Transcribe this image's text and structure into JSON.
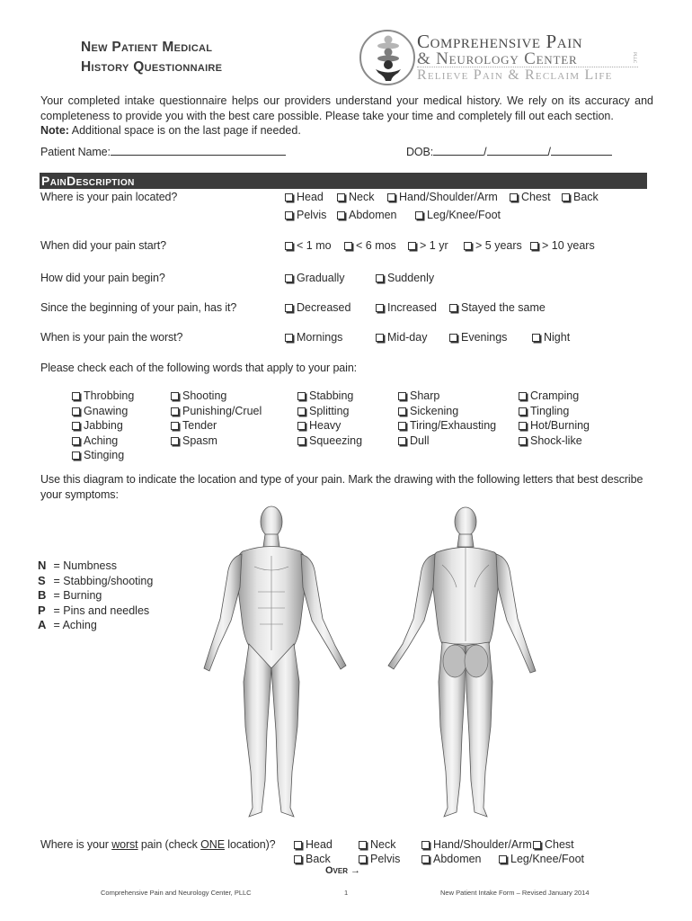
{
  "header": {
    "title_line1": "New Patient Medical",
    "title_line2": "History Questionnaire",
    "logo": {
      "line1": "Comprehensive Pain",
      "line2": "& Neurology Center",
      "pllc": "PLLC",
      "tagline": "Relieve Pain & Reclaim Life",
      "icon": "spine-figures-logo-icon",
      "colors": {
        "dark": "#2f2f2f",
        "mid": "#7a7a7a",
        "light": "#b0b0b0"
      }
    }
  },
  "intro": {
    "paragraph": "Your completed intake questionnaire helps our providers understand your medical history.  We rely on its accuracy and completeness to provide you with the best care possible.  Please take your time and completely fill out each section.",
    "note_label": "Note:",
    "note_text": "Additional space is on the last page if needed."
  },
  "patient": {
    "name_label": "Patient Name:",
    "name_value": "",
    "dob_label": "DOB:",
    "dob_month": "",
    "dob_day": "",
    "dob_year": "",
    "dob_separator": "/"
  },
  "section": {
    "title": "PainDescription",
    "bar_color": "#3c3c3c"
  },
  "questions": {
    "location": {
      "label": "Where is your pain located?",
      "options": [
        "Head",
        "Neck",
        "Hand/Shoulder/Arm",
        "Chest",
        "Back",
        "Pelvis",
        "Abdomen",
        "Leg/Knee/Foot"
      ]
    },
    "start": {
      "label": "When did your pain start?",
      "options": [
        "< 1 mo",
        "< 6 mos",
        "> 1 yr",
        "> 5 years",
        "> 10 years"
      ]
    },
    "begin": {
      "label": "How did your pain begin?",
      "options": [
        "Gradually",
        "Suddenly"
      ]
    },
    "since": {
      "label": "Since the beginning of your pain, has it?",
      "options": [
        "Decreased",
        "Increased",
        "Stayed the same"
      ]
    },
    "worst_time": {
      "label": "When is your pain the worst?",
      "options": [
        "Mornings",
        "Mid-day",
        "Evenings",
        "Night"
      ]
    },
    "words": {
      "label": "Please check each of the following words that apply to your pain:",
      "columns": [
        [
          "Throbbing",
          "Gnawing",
          "Jabbing",
          "Aching",
          "Stinging"
        ],
        [
          "Shooting",
          "Punishing/Cruel",
          "Tender",
          "Spasm"
        ],
        [
          "Stabbing",
          "Splitting",
          "Heavy",
          "Squeezing"
        ],
        [
          "Sharp",
          "Sickening",
          "Tiring/Exhausting",
          "Dull"
        ],
        [
          "Cramping",
          "Tingling",
          "Hot/Burning",
          "Shock-like"
        ]
      ]
    },
    "diagram": {
      "instructions": "Use this diagram to indicate the location and type of your pain.  Mark the drawing with the following letters that best describe your symptoms:",
      "legend": [
        {
          "letter": "N",
          "meaning": "= Numbness"
        },
        {
          "letter": "S",
          "meaning": "= Stabbing/shooting"
        },
        {
          "letter": "B",
          "meaning": "= Burning"
        },
        {
          "letter": "P",
          "meaning": "= Pins and needles"
        },
        {
          "letter": "A",
          "meaning": "= Aching"
        }
      ],
      "figures": [
        "front-body-figure",
        "back-body-figure"
      ]
    },
    "worst_location": {
      "label_pre": "Where is your ",
      "label_worst": "worst",
      "label_mid": " pain (check ",
      "label_one": "ONE",
      "label_post": " location)?",
      "options": [
        "Head",
        "Neck",
        "Hand/Shoulder/Arm",
        "Chest",
        "Back",
        "Pelvis",
        "Abdomen",
        "Leg/Knee/Foot"
      ]
    }
  },
  "over": "Over →",
  "footer": {
    "left": "Comprehensive Pain and Neurology Center, PLLC",
    "page": "1",
    "right": "New Patient Intake Form – Revised January 2014"
  }
}
